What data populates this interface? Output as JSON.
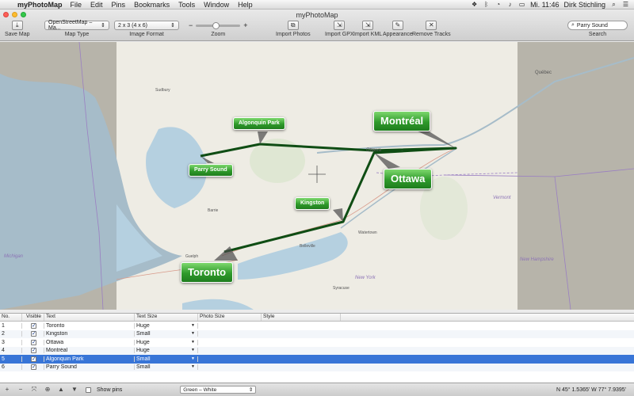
{
  "menubar": {
    "app_name": "myPhotoMap",
    "items": [
      "File",
      "Edit",
      "Pins",
      "Bookmarks",
      "Tools",
      "Window",
      "Help"
    ],
    "clock": "Mi. 11:46",
    "user": "Dirk Stichling"
  },
  "window": {
    "title": "myPhotoMap"
  },
  "toolbar": {
    "save_map": "Save Map",
    "map_type_label": "Map Type",
    "map_type_value": "OpenStreetMap – Ma...",
    "image_format_label": "Image Format",
    "image_format_value": "2 x 3 (4 x 6)",
    "zoom_label": "Zoom",
    "zoom_level": 0.45,
    "import_photos": "Import Photos",
    "import_gpx": "Import GPX",
    "import_kml": "Import KML",
    "appearance": "Appearance",
    "remove_tracks": "Remove Tracks",
    "search_value": "Parry Sound",
    "search_label": "Search"
  },
  "map": {
    "pins": [
      {
        "label": "Toronto",
        "size": "Huge"
      },
      {
        "label": "Kingston",
        "size": "Small"
      },
      {
        "label": "Ottawa",
        "size": "Huge"
      },
      {
        "label": "Montréal",
        "size": "Huge"
      },
      {
        "label": "Algonquin Park",
        "size": "Small"
      },
      {
        "label": "Parry Sound",
        "size": "Small"
      }
    ],
    "places": {
      "quebec": "Québec",
      "vermont": "Vermont",
      "new_hampshire": "New Hampshire",
      "michigan": "Michigan",
      "new_york": "New York",
      "ottawa_small": "Ottawa",
      "sudbury": "Sudbury",
      "barrie": "Barrie",
      "belleville": "Belleville",
      "guelph": "Guelph",
      "syracuse": "Syracuse",
      "watertown": "Watertown"
    }
  },
  "table": {
    "columns": [
      "No.",
      "Visible",
      "Text",
      "Text Size",
      "Photo Size",
      "Style"
    ],
    "rows": [
      {
        "no": "1",
        "visible": true,
        "text": "Toronto",
        "text_size": "Huge"
      },
      {
        "no": "2",
        "visible": true,
        "text": "Kingston",
        "text_size": "Small"
      },
      {
        "no": "3",
        "visible": true,
        "text": "Ottawa",
        "text_size": "Huge"
      },
      {
        "no": "4",
        "visible": true,
        "text": "Montréal",
        "text_size": "Huge"
      },
      {
        "no": "5",
        "visible": true,
        "text": "Algonquin Park",
        "text_size": "Small",
        "selected": true
      },
      {
        "no": "6",
        "visible": true,
        "text": "Parry Sound",
        "text_size": "Small"
      }
    ]
  },
  "bottombar": {
    "show_pins": "Show pins",
    "style_value": "Green – White",
    "coordinates": "N 45° 1.5365'  W 77° 7.9395'"
  },
  "colors": {
    "pin_green": "#2f9a2b",
    "track": "#0f4d14",
    "selection": "#3875d7"
  }
}
